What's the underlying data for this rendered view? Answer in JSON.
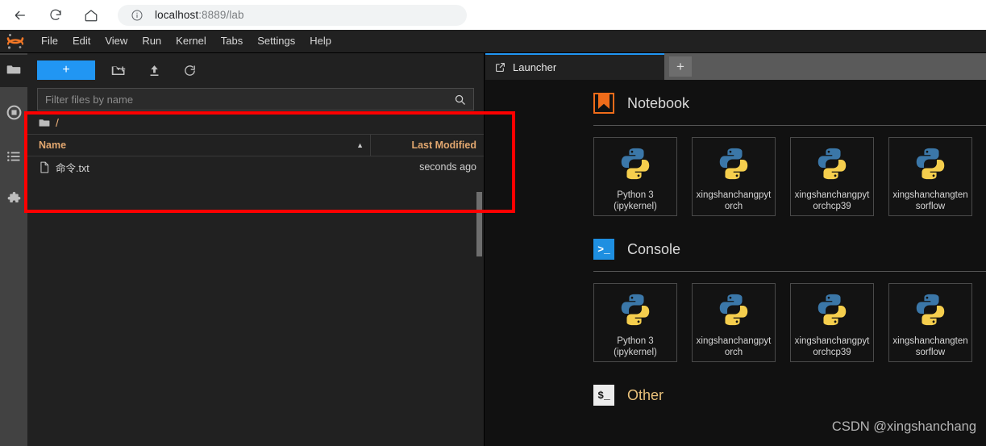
{
  "browser": {
    "back_icon": "arrow-left-icon",
    "reload_icon": "reload-icon",
    "home_icon": "home-icon",
    "info_icon": "info-circle-icon",
    "url_host": "localhost",
    "url_path": ":8889/lab",
    "url_full": "localhost:8889/lab"
  },
  "menubar": {
    "logo": "jupyter-logo",
    "items": [
      {
        "label": "File"
      },
      {
        "label": "Edit"
      },
      {
        "label": "View"
      },
      {
        "label": "Run"
      },
      {
        "label": "Kernel"
      },
      {
        "label": "Tabs"
      },
      {
        "label": "Settings"
      },
      {
        "label": "Help"
      }
    ]
  },
  "activity_bar": {
    "items": [
      {
        "name": "file-browser",
        "icon": "folder-icon",
        "active": true
      },
      {
        "name": "running-sessions",
        "icon": "stop-circle-icon",
        "active": false
      },
      {
        "name": "commands",
        "icon": "list-icon",
        "active": false
      },
      {
        "name": "extensions",
        "icon": "puzzle-icon",
        "active": false
      }
    ]
  },
  "file_browser": {
    "toolbar": {
      "new_launcher_label": "+",
      "new_folder_icon": "new-folder-icon",
      "upload_icon": "upload-icon",
      "refresh_icon": "refresh-icon"
    },
    "filter": {
      "placeholder": "Filter files by name",
      "value": "",
      "search_icon": "search-icon"
    },
    "breadcrumb": {
      "folder_icon": "folder-icon",
      "path": "/"
    },
    "columns": {
      "name": "Name",
      "last_modified": "Last Modified",
      "sort_arrow": "▲"
    },
    "files": [
      {
        "icon": "text-file-icon",
        "name": "命令.txt",
        "last_modified": "seconds ago"
      }
    ]
  },
  "annotation": {
    "color": "#fe0000"
  },
  "launcher": {
    "tabs": [
      {
        "label": "Launcher",
        "icon": "launch-icon",
        "active": true
      }
    ],
    "add_tab_label": "+",
    "sections": [
      {
        "title": "Notebook",
        "icon": "notebook-icon",
        "cards": [
          {
            "label": "Python 3\n(ipykernel)",
            "icon": "python-icon"
          },
          {
            "label": "xingshanchangpytorch",
            "icon": "python-icon"
          },
          {
            "label": "xingshanchangpytorchcp39",
            "icon": "python-icon"
          },
          {
            "label": "xingshanchangtensorflow",
            "icon": "python-icon"
          }
        ]
      },
      {
        "title": "Console",
        "icon": "console-icon",
        "cards": [
          {
            "label": "Python 3\n(ipykernel)",
            "icon": "python-icon"
          },
          {
            "label": "xingshanchangpytorch",
            "icon": "python-icon"
          },
          {
            "label": "xingshanchangpytorchcp39",
            "icon": "python-icon"
          },
          {
            "label": "xingshanchangtensorflow",
            "icon": "python-icon"
          }
        ]
      },
      {
        "title": "Other",
        "icon": "terminal-icon",
        "cards": []
      }
    ]
  },
  "watermark": {
    "text": "CSDN @xingshanchang"
  }
}
